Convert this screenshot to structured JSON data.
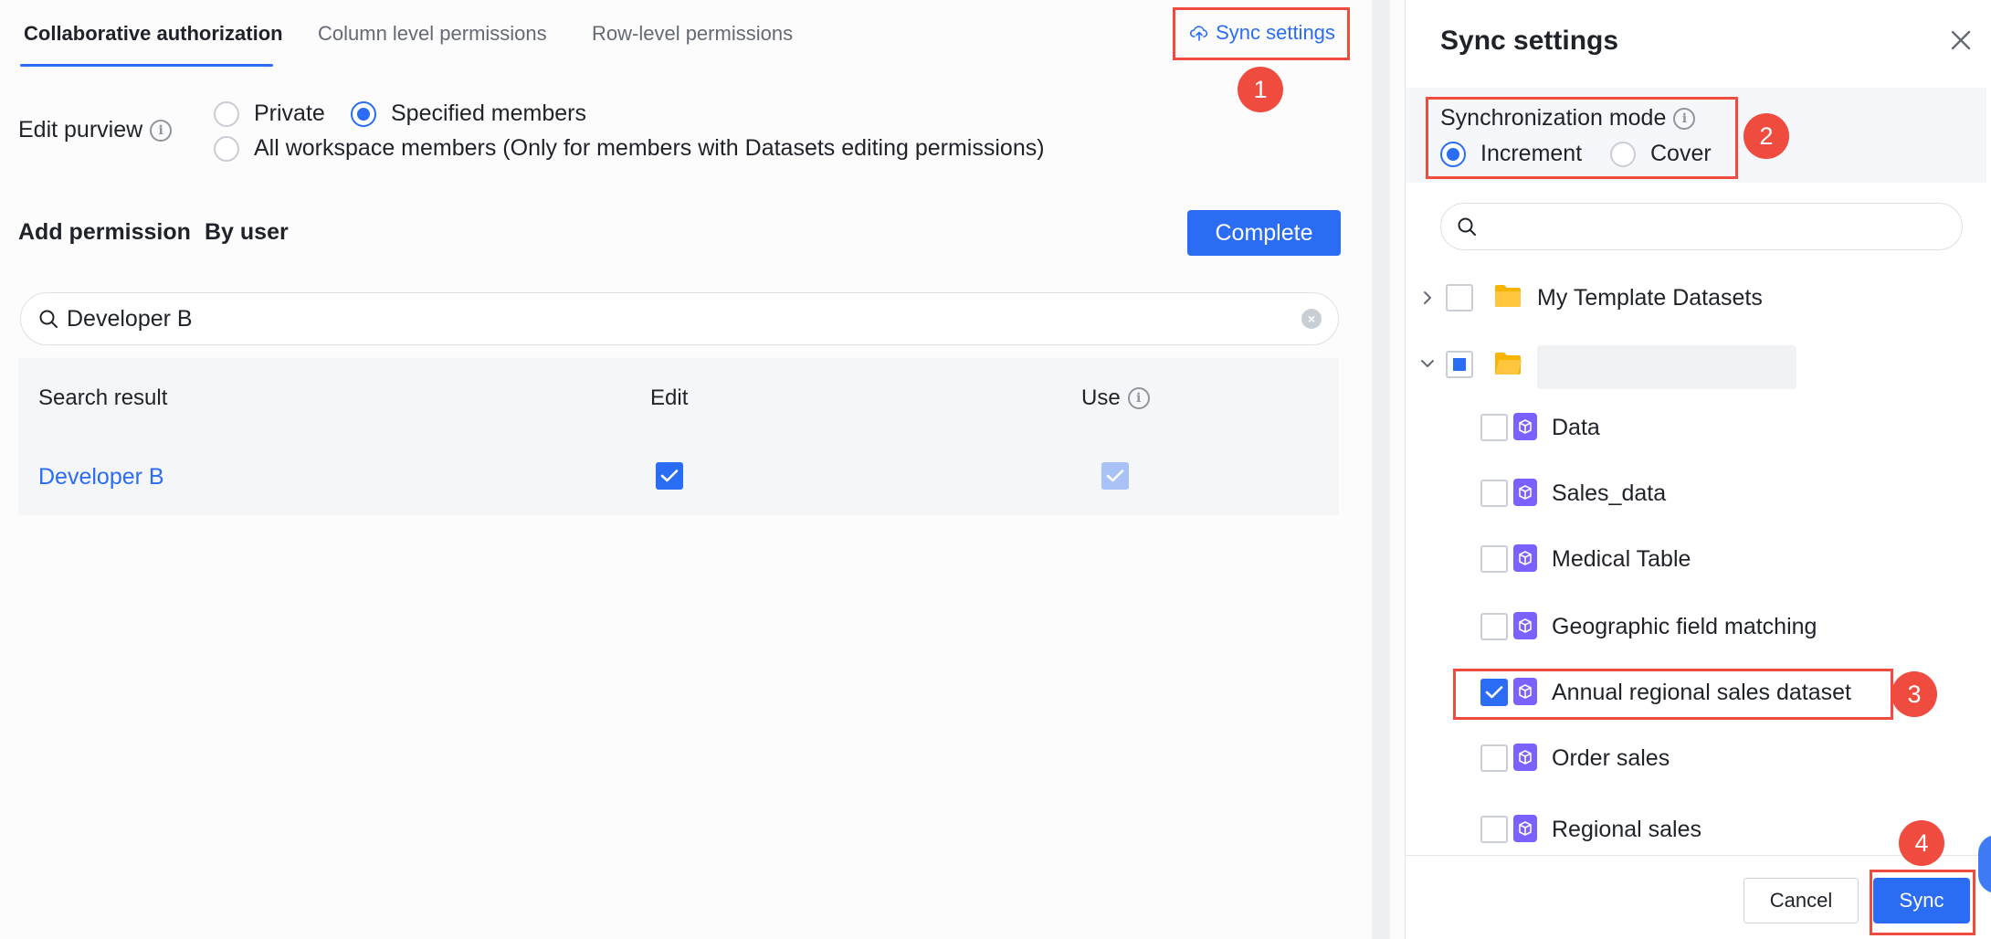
{
  "tabs": [
    {
      "label": "Collaborative authorization",
      "active": true
    },
    {
      "label": "Column level permissions",
      "active": false
    },
    {
      "label": "Row-level permissions",
      "active": false
    }
  ],
  "header": {
    "sync_settings_label": "Sync settings",
    "sync_icon": "cloud-sync-icon"
  },
  "edit_purview": {
    "label": "Edit purview",
    "options": [
      {
        "label": "Private",
        "selected": false
      },
      {
        "label": "Specified members",
        "selected": true
      },
      {
        "label": "All workspace members (Only for members with Datasets editing permissions)",
        "selected": false
      }
    ]
  },
  "add_permission": {
    "title": "Add permission",
    "mode": "By user",
    "complete_label": "Complete"
  },
  "search": {
    "value": "Developer B",
    "placeholder": ""
  },
  "results": {
    "columns": [
      "Search result",
      "Edit",
      "Use"
    ],
    "rows": [
      {
        "name": "Developer B",
        "edit": true,
        "use": true
      }
    ]
  },
  "drawer": {
    "title": "Sync settings",
    "mode_label": "Synchronization mode",
    "modes": [
      {
        "label": "Increment",
        "selected": true
      },
      {
        "label": "Cover",
        "selected": false
      }
    ],
    "search_placeholder": "",
    "tree": {
      "folders": [
        {
          "name": "My Template Datasets",
          "expanded": false,
          "checked": "none"
        },
        {
          "name": "",
          "expanded": true,
          "checked": "partial"
        }
      ],
      "datasets": [
        {
          "name": "Data",
          "checked": false
        },
        {
          "name": "Sales_data",
          "checked": false
        },
        {
          "name": "Medical Table",
          "checked": false
        },
        {
          "name": "Geographic field matching",
          "checked": false
        },
        {
          "name": "Annual regional sales dataset",
          "checked": true
        },
        {
          "name": "Order sales",
          "checked": false
        },
        {
          "name": "Regional sales",
          "checked": false
        }
      ]
    },
    "cancel_label": "Cancel",
    "sync_label": "Sync"
  },
  "annotations": {
    "step1": "1",
    "step2": "2",
    "step3": "3",
    "step4": "4"
  },
  "colors": {
    "accent": "#2a6df4",
    "highlight": "#ef4b3f",
    "folder": "#f7b500",
    "dataset": "#7b61ff"
  }
}
